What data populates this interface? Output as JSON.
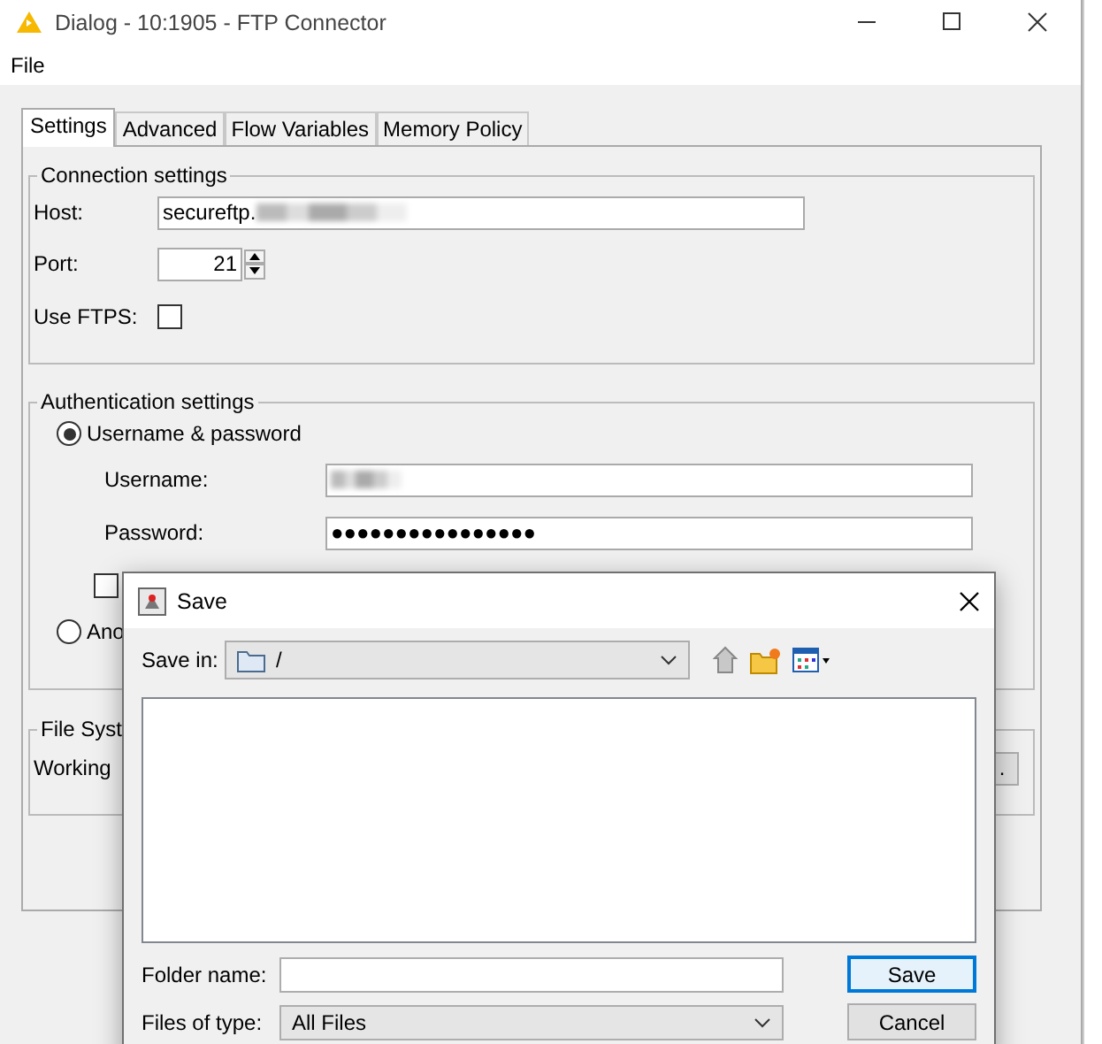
{
  "window": {
    "title": "Dialog - 10:1905 - FTP Connector"
  },
  "menu": [
    "File"
  ],
  "tabs": [
    {
      "label": "Settings",
      "selected": true
    },
    {
      "label": "Advanced",
      "selected": false
    },
    {
      "label": "Flow Variables",
      "selected": false
    },
    {
      "label": "Memory Policy",
      "selected": false
    }
  ],
  "connection": {
    "title": "Connection settings",
    "host_label": "Host:",
    "host_value": "secureftp.",
    "port_label": "Port:",
    "port_value": "21",
    "ftps_label": "Use FTPS:",
    "ftps_checked": false
  },
  "authentication": {
    "title": "Authentication settings",
    "username_label": "Username:",
    "password_label": "Password:",
    "password_value": "●●●●●●●●●●●●●●●●",
    "extra_checkbox_checked": false,
    "options": [
      {
        "label": "Username & password",
        "selected": true
      },
      {
        "label": "Ano",
        "selected": false
      }
    ]
  },
  "file_system": {
    "title": "File Syst",
    "working_dir_label": "Working",
    "browse_label": "."
  },
  "save_dialog": {
    "title": "Save",
    "save_in_label": "Save in:",
    "save_in_value": "/",
    "folder_name_label": "Folder name:",
    "files_of_type_label": "Files of type:",
    "files_of_type_value": "All Files",
    "buttons": [
      {
        "label": "Save",
        "focused": true
      },
      {
        "label": "Cancel",
        "focused": false
      }
    ]
  }
}
